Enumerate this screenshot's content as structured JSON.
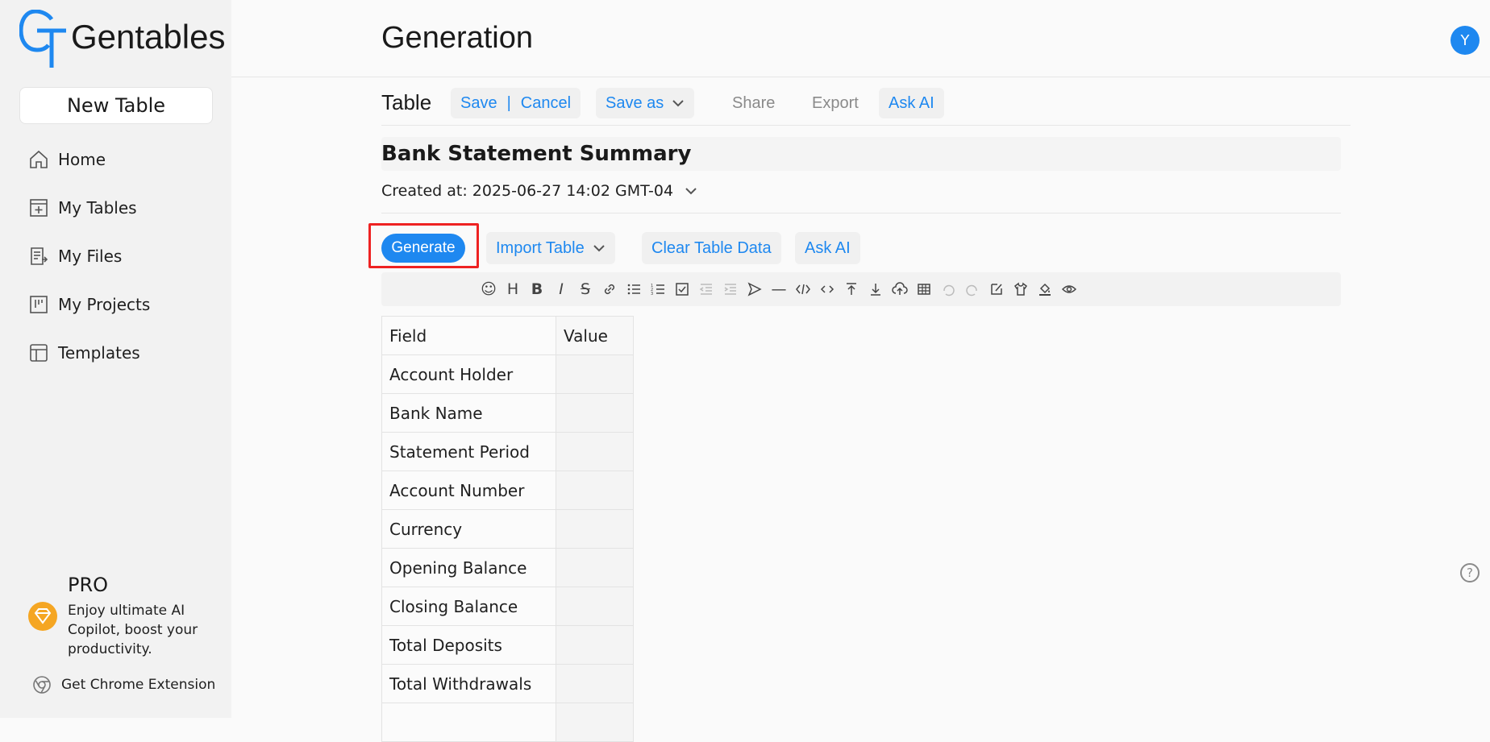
{
  "app": {
    "name": "Gentables"
  },
  "sidebar": {
    "new_table_label": "New Table",
    "items": [
      {
        "label": "Home",
        "icon": "home-icon"
      },
      {
        "label": "My Tables",
        "icon": "table-add-icon"
      },
      {
        "label": "My Files",
        "icon": "file-icon"
      },
      {
        "label": "My Projects",
        "icon": "project-icon"
      },
      {
        "label": "Templates",
        "icon": "template-icon"
      }
    ],
    "pro": {
      "title": "PRO",
      "description": "Enjoy ultimate AI Copilot, boost your productivity."
    },
    "chrome_extension_label": "Get Chrome Extension"
  },
  "header": {
    "title": "Generation",
    "avatar_initial": "Y"
  },
  "toolbar": {
    "label": "Table",
    "save_label": "Save",
    "separator": "|",
    "cancel_label": "Cancel",
    "save_as_label": "Save as",
    "share_label": "Share",
    "export_label": "Export",
    "ask_ai_label": "Ask AI"
  },
  "document": {
    "title": "Bank Statement Summary",
    "created_at": "Created at: 2025-06-27 14:02 GMT-04"
  },
  "actions": {
    "generate_label": "Generate",
    "import_table_label": "Import Table",
    "clear_table_label": "Clear Table Data",
    "ask_ai_label": "Ask AI"
  },
  "table": {
    "headers": [
      "Field",
      "Value"
    ],
    "rows": [
      [
        "Account Holder",
        ""
      ],
      [
        "Bank Name",
        ""
      ],
      [
        "Statement Period",
        ""
      ],
      [
        "Account Number",
        ""
      ],
      [
        "Currency",
        ""
      ],
      [
        "Opening Balance",
        ""
      ],
      [
        "Closing Balance",
        ""
      ],
      [
        "Total Deposits",
        ""
      ],
      [
        "Total Withdrawals",
        ""
      ],
      [
        "",
        ""
      ]
    ]
  },
  "help": {
    "symbol": "?"
  },
  "colors": {
    "accent": "#1e88f0",
    "highlight": "#ee2222",
    "pro_badge": "#f5a623"
  }
}
